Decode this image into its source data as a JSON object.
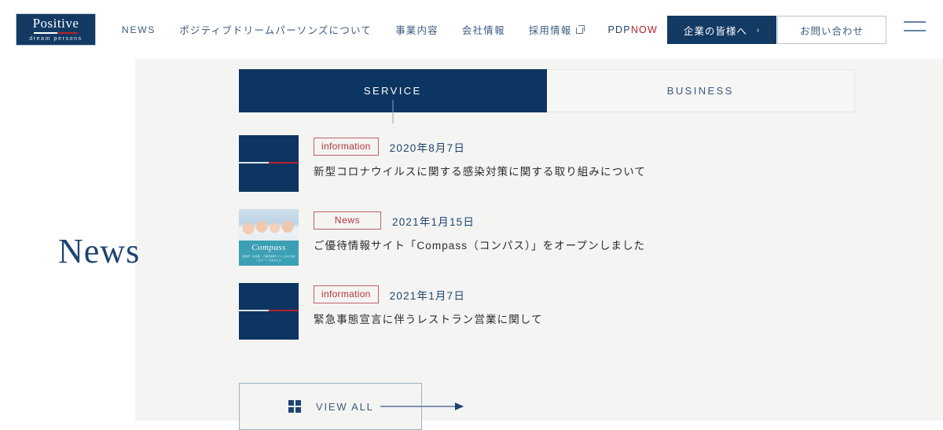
{
  "header": {
    "logo": {
      "main": "Positive",
      "sub": "dream persons",
      "name": "positive-dream-persons-logo"
    },
    "nav": [
      {
        "label": "NEWS",
        "type": "en",
        "external": false
      },
      {
        "label": "ポジティブドリームパーソンズについて",
        "type": "jp",
        "external": false
      },
      {
        "label": "事業内容",
        "type": "jp",
        "external": false
      },
      {
        "label": "会社情報",
        "type": "jp",
        "external": false
      },
      {
        "label": "採用情報",
        "type": "jp",
        "external": true
      }
    ],
    "pdpnow": {
      "prefix": "PDP",
      "suffix": "NOW"
    },
    "corporate_button": {
      "label": "企業の皆様へ",
      "chevron": "›"
    },
    "contact_button": {
      "label": "お問い合わせ"
    },
    "menu_icon": "hamburger-menu-icon"
  },
  "section": {
    "title": "News"
  },
  "tabs": [
    {
      "label": "SERVICE",
      "active": true
    },
    {
      "label": "BUSINESS",
      "active": false
    }
  ],
  "news": [
    {
      "badge": "information",
      "date": "2020年8月7日",
      "title": "新型コロナウイルスに関する感染対策に関する取り組みについて",
      "thumb": "logo-placeholder"
    },
    {
      "badge": "News",
      "date": "2021年1月15日",
      "title": "ご優待情報サイト「Compass（コンパス）」をオープンしました",
      "thumb": "compass-photo",
      "thumb_script": "Compass",
      "thumb_caption": "結婚式・お食事・ご優待情報サイトしあわせ感じるシーンであなたの"
    },
    {
      "badge": "information",
      "date": "2021年1月7日",
      "title": "緊急事態宣言に伴うレストラン営業に関して",
      "thumb": "logo-placeholder"
    }
  ],
  "view_all": {
    "label": "VIEW ALL",
    "icon": "grid-icon"
  },
  "colors": {
    "navy": "#0d3561",
    "navy_text": "#1d4470",
    "link_blue": "#3b5a80",
    "red": "#b3232c",
    "badge_red": "#b3353f",
    "panel_bg": "#f4f4f2",
    "teal": "#3ba0b4"
  }
}
